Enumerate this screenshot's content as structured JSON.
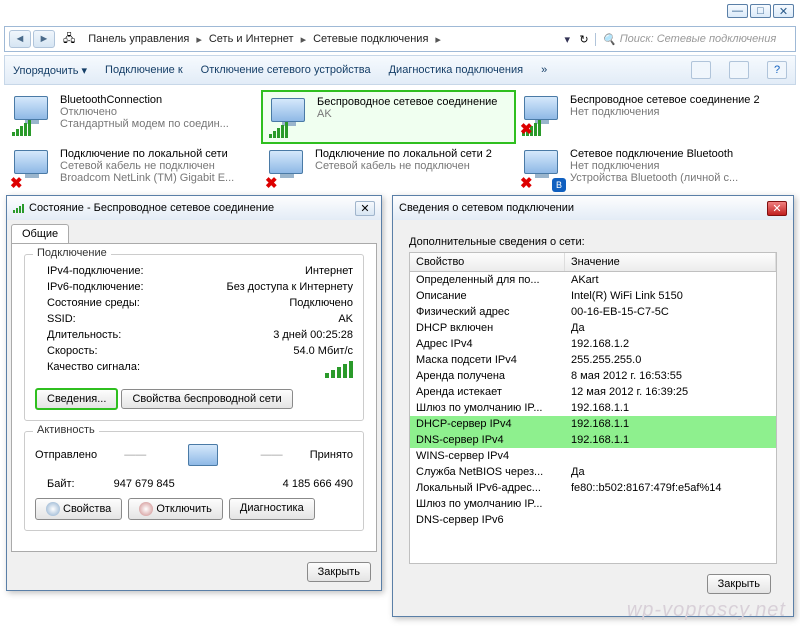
{
  "window_controls": {
    "min": "—",
    "max": "□",
    "close": "✕"
  },
  "addressbar": {
    "back": "◄",
    "fwd": "►",
    "crumbs": [
      "Панель управления",
      "Сеть и Интернет",
      "Сетевые подключения"
    ],
    "search_placeholder": "Поиск: Сетевые подключения"
  },
  "toolbar": {
    "organize": "Упорядочить ▾",
    "connect": "Подключение к",
    "disable": "Отключение сетевого устройства",
    "diag": "Диагностика подключения",
    "more": "»"
  },
  "connections": [
    {
      "title": "BluetoothConnection",
      "line2": "Отключено",
      "line3": "Стандартный модем по соедин...",
      "x": false,
      "bt": false,
      "bars": true
    },
    {
      "title": "Беспроводное сетевое соединение",
      "line2": "AK",
      "line3": "",
      "x": false,
      "bt": false,
      "bars": true,
      "hl": true
    },
    {
      "title": "Беспроводное сетевое соединение 2",
      "line2": "Нет подключения",
      "line3": "",
      "x": true,
      "bt": false,
      "bars": true
    },
    {
      "title": "Подключение по локальной сети",
      "line2": "Сетевой кабель не подключен",
      "line3": "Broadcom NetLink (TM) Gigabit E...",
      "x": true,
      "bt": false,
      "bars": false
    },
    {
      "title": "Подключение по локальной сети 2",
      "line2": "Сетевой кабель не подключен",
      "line3": "",
      "x": true,
      "bt": false,
      "bars": false
    },
    {
      "title": "Сетевое подключение Bluetooth",
      "line2": "Нет подключения",
      "line3": "Устройства Bluetooth (личной с...",
      "x": true,
      "bt": true,
      "bars": false
    }
  ],
  "status": {
    "title": "Состояние - Беспроводное сетевое соединение",
    "tab": "Общие",
    "group_conn": "Подключение",
    "rows": {
      "ipv4": {
        "k": "IPv4-подключение:",
        "v": "Интернет"
      },
      "ipv6": {
        "k": "IPv6-подключение:",
        "v": "Без доступа к Интернету"
      },
      "media": {
        "k": "Состояние среды:",
        "v": "Подключено"
      },
      "ssid": {
        "k": "SSID:",
        "v": "AK"
      },
      "dur": {
        "k": "Длительность:",
        "v": "3 дней 00:25:28"
      },
      "speed": {
        "k": "Скорость:",
        "v": "54.0 Мбит/с"
      },
      "qual": {
        "k": "Качество сигнала:",
        "v": ""
      }
    },
    "btn_details": "Сведения...",
    "btn_wprops": "Свойства беспроводной сети",
    "group_act": "Активность",
    "sent": "Отправлено",
    "recv": "Принято",
    "bytes_label": "Байт:",
    "bytes_sent": "947 679 845",
    "bytes_recv": "4 185 666 490",
    "btn_props": "Свойства",
    "btn_off": "Отключить",
    "btn_diag": "Диагностика",
    "btn_close": "Закрыть"
  },
  "details": {
    "title": "Сведения о сетевом подключении",
    "desc": "Дополнительные сведения о сети:",
    "col_prop": "Свойство",
    "col_val": "Значение",
    "rows": [
      {
        "p": "Определенный для по...",
        "v": "AKart"
      },
      {
        "p": "Описание",
        "v": "Intel(R) WiFi Link 5150"
      },
      {
        "p": "Физический адрес",
        "v": "00-16-EB-15-C7-5C"
      },
      {
        "p": "DHCP включен",
        "v": "Да"
      },
      {
        "p": "Адрес IPv4",
        "v": "192.168.1.2"
      },
      {
        "p": "Маска подсети IPv4",
        "v": "255.255.255.0"
      },
      {
        "p": "Аренда получена",
        "v": "8 мая 2012 г. 16:53:55"
      },
      {
        "p": "Аренда истекает",
        "v": "12 мая 2012 г. 16:39:25"
      },
      {
        "p": "Шлюз по умолчанию IP...",
        "v": "192.168.1.1"
      },
      {
        "p": "DHCP-сервер IPv4",
        "v": "192.168.1.1",
        "hl": true
      },
      {
        "p": "DNS-сервер IPv4",
        "v": "192.168.1.1",
        "hl": true
      },
      {
        "p": "WINS-сервер IPv4",
        "v": ""
      },
      {
        "p": "Служба NetBIOS через...",
        "v": "Да"
      },
      {
        "p": "Локальный IPv6-адрес...",
        "v": "fe80::b502:8167:479f:e5af%14"
      },
      {
        "p": "Шлюз по умолчанию IP...",
        "v": ""
      },
      {
        "p": "DNS-сервер IPv6",
        "v": ""
      }
    ],
    "btn_close": "Закрыть"
  },
  "watermark": "wp-voproscy.net"
}
